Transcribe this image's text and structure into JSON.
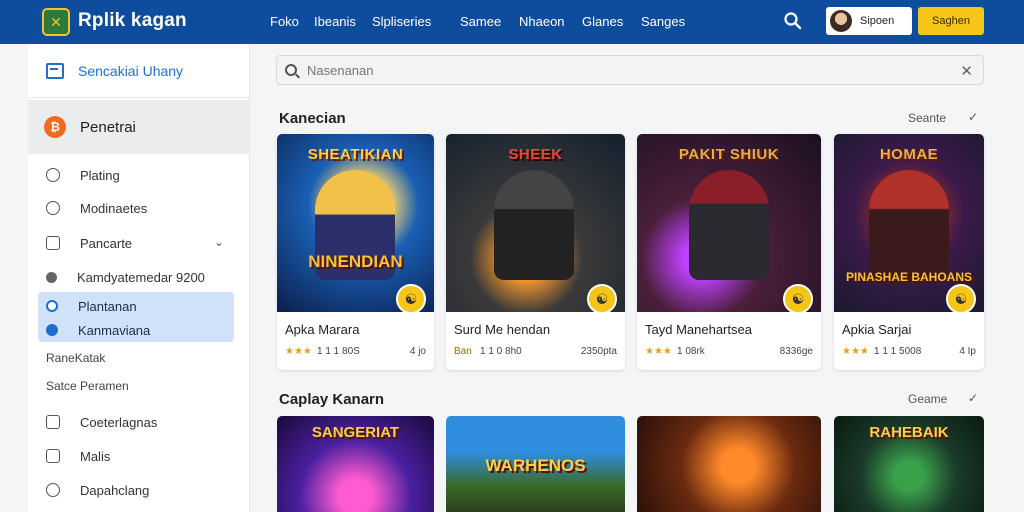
{
  "topbar": {
    "logo_glyph": "✕",
    "brand": "Rplik kagan",
    "nav": [
      "Foko",
      "Ibeanis",
      "Slpliseries",
      "Samee",
      "Nhaeon",
      "Glanes",
      "Sanges"
    ],
    "account_label": "Sipoen",
    "signup_label": "Saghen"
  },
  "sidebar": {
    "header": "Sencakiai Uhany",
    "active_item": "Penetrai",
    "active_icon": "₿",
    "items": [
      "Plating",
      "Modinaetes",
      "Pancarte",
      "Kamdyatemedar 9200"
    ],
    "selected": [
      "Plantanan",
      "Kanmaviana"
    ],
    "plain": [
      "RaneKatak",
      "Satce Peramen"
    ],
    "bottom_items": [
      "Coeterlagnas",
      "Malis",
      "Dapahclang"
    ]
  },
  "search": {
    "placeholder": "Nasenanan"
  },
  "section1": {
    "title": "Kanecian",
    "more": "Seante",
    "cards": [
      {
        "art_top": "SHEATIKIAN",
        "art_bottom": "NINENDIAN",
        "name": "Apka Marara",
        "stars": "★★★",
        "meta": "1 1 1 80S",
        "size": "4 jo"
      },
      {
        "art_top": "SHEEK",
        "art_bottom": "",
        "name": "Surd Me hendan",
        "stars": "Ban",
        "meta": "1 1 0 8h0",
        "size": "2350pta"
      },
      {
        "art_top": "PAKIT SHIUK",
        "art_bottom": "",
        "name": "Tayd Manehartsea",
        "stars": "★★★",
        "meta": "1 08rk",
        "size": "8336ge"
      },
      {
        "art_top": "HOMAE",
        "art_bottom": "PINASHAE BAHOANS",
        "name": "Apkia Sarjai",
        "stars": "★★★",
        "meta": "1 1 1 5008",
        "size": "4 Ip"
      }
    ]
  },
  "section2": {
    "title": "Caplay Kanarn",
    "more": "Geame",
    "cards": [
      {
        "art_top": "SANGERIAT",
        "art_mid": ""
      },
      {
        "art_top": "",
        "art_mid": "WARHENOS"
      },
      {
        "art_top": "",
        "art_mid": ""
      },
      {
        "art_top": "RAHEBAIK",
        "art_mid": ""
      }
    ]
  }
}
